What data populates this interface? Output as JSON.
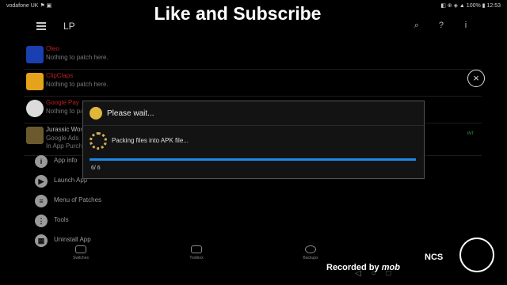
{
  "status_bar": {
    "carrier": "vodafone UK",
    "carrier_icons": "⚑ ▣",
    "right_icons": "◧ ⊕ ◈ ▲ 100% ▮",
    "time": "12:53"
  },
  "overlay": {
    "title": "Like and Subscribe",
    "recorded_label": "Recorded by",
    "recorded_brand": "mob",
    "ncs_logo": "NCS"
  },
  "appbar": {
    "title": "LP",
    "search_glyph": "⌕",
    "help_glyph": "?",
    "info_glyph": "i"
  },
  "apps": [
    {
      "name": "Oleo",
      "status": "Nothing to patch here.",
      "tag": "",
      "icon_color": "#1a3fb0"
    },
    {
      "name": "ClipClaps",
      "status": "Nothing to patch here.",
      "tag": "",
      "icon_color": "#e6a21a"
    },
    {
      "name": "Google Pay",
      "status": "Nothing to patch here.",
      "tag": "",
      "icon_color": "#dcdcdc"
    },
    {
      "name": "Jurassic World",
      "status": "Google Ads",
      "status2": "In App Purchases",
      "tag": "INT",
      "icon_color": "#6b5a2e"
    }
  ],
  "menu": [
    {
      "label": "App info",
      "glyph": "i"
    },
    {
      "label": "Launch App",
      "glyph": "▶"
    },
    {
      "label": "Menu of Patches",
      "glyph": "≡"
    },
    {
      "label": "Tools",
      "glyph": "⋮"
    },
    {
      "label": "Uninstall App",
      "glyph": "▦"
    }
  ],
  "bottom_nav": [
    {
      "label": "Switches"
    },
    {
      "label": "Toolbox"
    },
    {
      "label": "Backups"
    }
  ],
  "dialog": {
    "title": "Please wait...",
    "message": "Packing files into APK file...",
    "progress_text": "6/ 6",
    "progress_fraction": 1.0,
    "accent_color": "#1e88e5"
  },
  "close_glyph": "×",
  "system_nav": {
    "back": "◁",
    "home": "○",
    "recents": "□"
  }
}
